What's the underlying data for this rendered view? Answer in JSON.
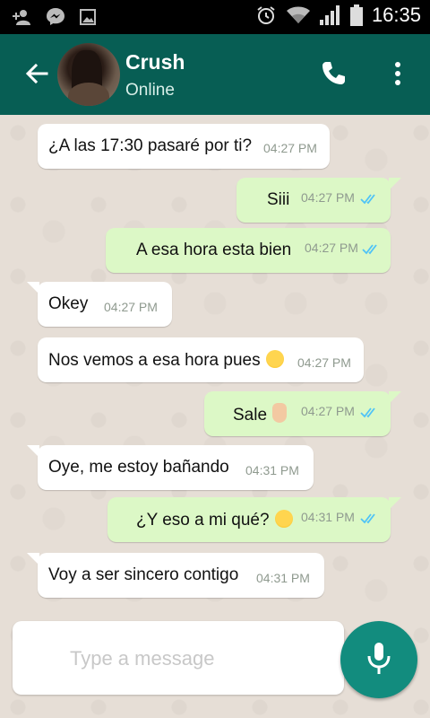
{
  "status_bar": {
    "time": "16:35",
    "icons": [
      "person-add-icon",
      "messenger-icon",
      "gallery-icon",
      "alarm-icon",
      "wifi-icon",
      "signal-icon",
      "battery-icon"
    ]
  },
  "header": {
    "contact_name": "Crush",
    "status": "Online",
    "icons": [
      "back-arrow-icon",
      "phone-icon",
      "more-vert-icon"
    ]
  },
  "messages": [
    {
      "direction": "in",
      "text": "¿A las 17:30 pasaré por ti?",
      "time": "04:27 PM"
    },
    {
      "direction": "out",
      "text": "Siii",
      "time": "04:27 PM",
      "read": true
    },
    {
      "direction": "out",
      "text": "A esa hora esta bien",
      "time": "04:27 PM",
      "read": true
    },
    {
      "direction": "in",
      "text": "Okey",
      "time": "04:27 PM"
    },
    {
      "direction": "in",
      "text": "Nos vemos a esa hora pues",
      "emoji": "kissing-face",
      "time": "04:27 PM"
    },
    {
      "direction": "out",
      "text": "Sale",
      "emoji": "raised-hand",
      "time": "04:27 PM",
      "read": true
    },
    {
      "direction": "in",
      "text": "Oye, me estoy bañando",
      "time": "04:31 PM"
    },
    {
      "direction": "out",
      "text": "¿Y eso a mi qué?",
      "emoji": "flushed-face",
      "time": "04:31 PM",
      "read": true
    },
    {
      "direction": "in",
      "text": "Voy a ser sincero contigo",
      "time": "04:31 PM"
    }
  ],
  "composer": {
    "placeholder": "Type a message",
    "value": ""
  },
  "colors": {
    "header": "#075e54",
    "outgoing_bubble": "#dcf8c6",
    "incoming_bubble": "#ffffff",
    "fab": "#128c7e",
    "read_ticks": "#4fc3f7"
  }
}
